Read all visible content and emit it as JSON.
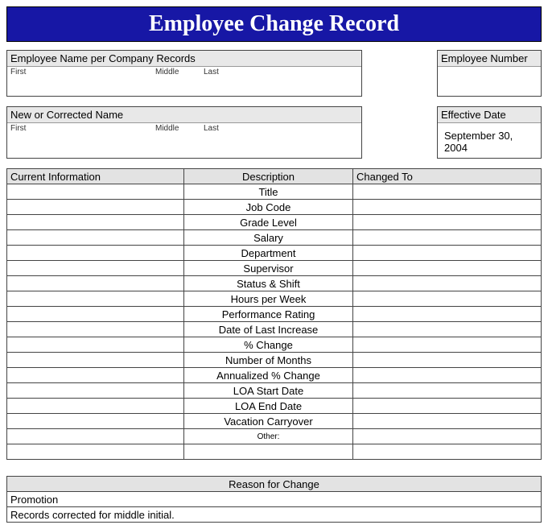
{
  "title": "Employee Change Record",
  "employeeNameLabel": "Employee Name per Company Records",
  "employeeNumberLabel": "Employee Number",
  "newNameLabel": "New or Corrected Name",
  "effectiveDateLabel": "Effective Date",
  "effectiveDate": "September 30, 2004",
  "fml": {
    "first": "First",
    "middle": "Middle",
    "last": "Last"
  },
  "columns": {
    "currentInfo": "Current Information",
    "description": "Description",
    "changedTo": "Changed To"
  },
  "rows": [
    "Title",
    "Job Code",
    "Grade Level",
    "Salary",
    "Department",
    "Supervisor",
    "Status & Shift",
    "Hours per Week",
    "Performance Rating",
    "Date of Last Increase",
    "% Change",
    "Number of Months",
    "Annualized % Change",
    "LOA Start Date",
    "LOA End Date",
    "Vacation Carryover"
  ],
  "otherLabel": "Other:",
  "reasonHeader": "Reason for Change",
  "reasons": [
    "Promotion",
    "Records corrected for middle initial."
  ]
}
